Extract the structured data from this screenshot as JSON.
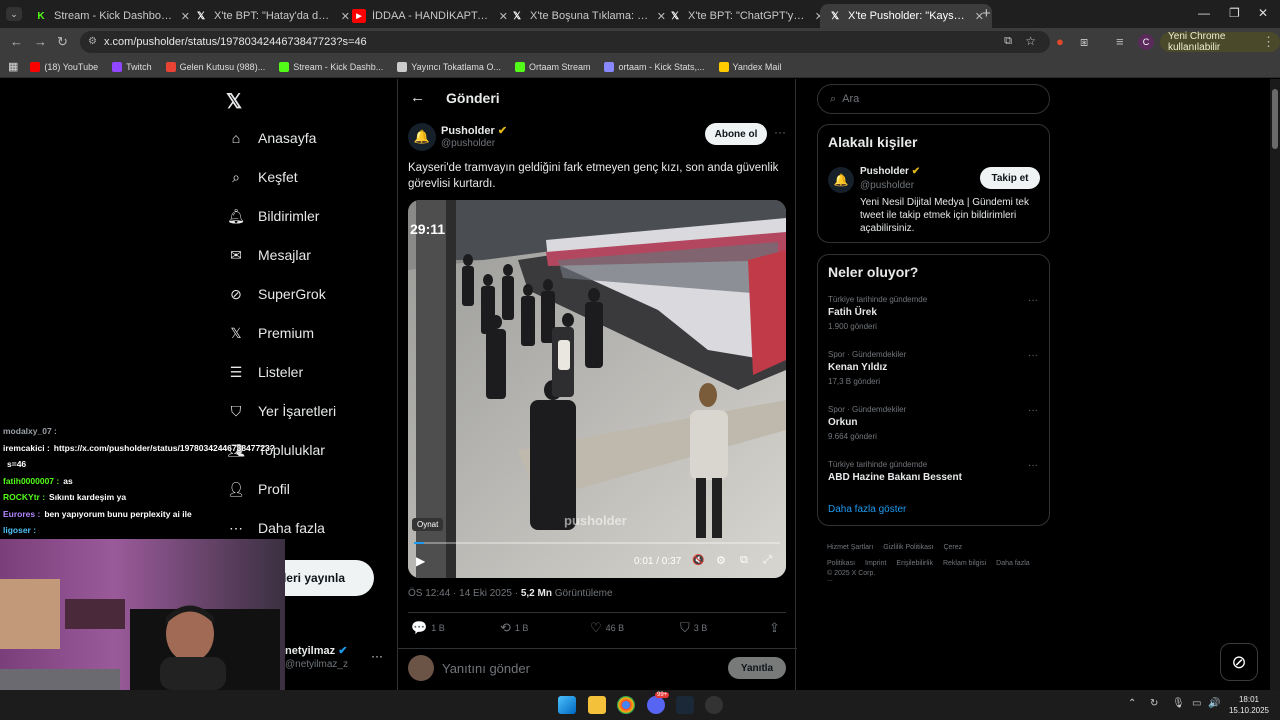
{
  "browser": {
    "tabs": [
      {
        "title": "Stream - Kick Dashboard",
        "icon": "kick-icon",
        "color": "#53fc18"
      },
      {
        "title": "X'te BPT: \"Hatay'da depremin e",
        "icon": "x-icon",
        "color": "#ffffff"
      },
      {
        "title": "İDDAA - HANDİKAPTAN KAZAN",
        "icon": "youtube-icon",
        "color": "#ff0000"
      },
      {
        "title": "X'te Boşuna Tıklama: \"Japonya'",
        "icon": "x-icon",
        "color": "#ffffff"
      },
      {
        "title": "X'te BPT: \"ChatGPT'ye cinsel içe",
        "icon": "x-icon",
        "color": "#ffffff"
      },
      {
        "title": "X'te Pusholder: \"Kayseri'de tram",
        "icon": "x-icon",
        "color": "#ffffff",
        "active": true
      }
    ],
    "url": "x.com/pusholder/status/1978034244673847723?s=46",
    "new_chrome_label": "Yeni Chrome kullanılabilir",
    "profile_initial": "C",
    "bookmarks": [
      {
        "label": "(18) YouTube",
        "color": "#ff0000"
      },
      {
        "label": "Twitch",
        "color": "#9146ff"
      },
      {
        "label": "Gelen Kutusu (988)...",
        "color": "#ea4335"
      },
      {
        "label": "Stream - Kick Dashb...",
        "color": "#53fc18"
      },
      {
        "label": "Yayıncı Tokatlama O...",
        "color": "#cccccc"
      },
      {
        "label": "Ortaam Stream",
        "color": "#53fc18"
      },
      {
        "label": "ortaam - Kick Stats,...",
        "color": "#8888ff"
      },
      {
        "label": "Yandex Mail",
        "color": "#ffcc00"
      }
    ]
  },
  "nav": {
    "items": [
      {
        "label": "Anasayfa",
        "icon": "home-icon"
      },
      {
        "label": "Keşfet",
        "icon": "search-icon"
      },
      {
        "label": "Bildirimler",
        "icon": "bell-icon"
      },
      {
        "label": "Mesajlar",
        "icon": "mail-icon"
      },
      {
        "label": "SuperGrok",
        "icon": "grok-icon"
      },
      {
        "label": "Premium",
        "icon": "x-icon"
      },
      {
        "label": "Listeler",
        "icon": "list-icon"
      },
      {
        "label": "Yer İşaretleri",
        "icon": "bookmark-icon"
      },
      {
        "label": "Topluluklar",
        "icon": "people-icon"
      },
      {
        "label": "Profil",
        "icon": "user-icon"
      },
      {
        "label": "Daha fazla",
        "icon": "more-circle-icon"
      }
    ],
    "post_button": "Gönderi yayınla",
    "account_name": "netyilmaz",
    "account_handle": "@netyilmaz_z"
  },
  "post": {
    "header_title": "Gönderi",
    "author_name": "Pusholder",
    "author_handle": "@pusholder",
    "subscribe_label": "Abone ol",
    "text": "Kayseri'de tramvayın geldiğini fark etmeyen genç kızı, son anda güvenlik görevlisi kurtardı.",
    "video": {
      "timestamp_overlay": "29:11",
      "watermark": "pusholder",
      "play_tooltip": "Oynat",
      "time": "0:01 / 0:37",
      "progress": 0.027
    },
    "meta_time": "ÖS 12:44 · 14 Eki 2025 · ",
    "views_count": "5,2 Mn",
    "views_label": " Görüntüleme",
    "stats": {
      "replies": "1 B",
      "reposts": "1 B",
      "likes": "46 B",
      "bookmarks": "3 B"
    },
    "reply_placeholder": "Yanıtını gönder",
    "reply_button": "Yanıtla"
  },
  "sidebar": {
    "search_placeholder": "Ara",
    "related_title": "Alakalı kişiler",
    "related": {
      "name": "Pusholder",
      "handle": "@pusholder",
      "follow_label": "Takip et",
      "bio": "Yeni Nesil Dijital Medya | Gündemi tek tweet ile takip etmek için bildirimleri açabilirsiniz."
    },
    "trends_title": "Neler oluyor?",
    "trends": [
      {
        "category": "Türkiye tarihinde gündemde",
        "name": "Fatih Ürek",
        "count": "1.900 gönderi"
      },
      {
        "category": "Spor · Gündemdekiler",
        "name": "Kenan Yıldız",
        "count": "17,3 B gönderi"
      },
      {
        "category": "Spor · Gündemdekiler",
        "name": "Orkun",
        "count": "9.664 gönderi"
      },
      {
        "category": "Türkiye tarihinde gündemde",
        "name": "ABD Hazine Bakanı Bessent",
        "count": ""
      }
    ],
    "show_more": "Daha fazla göster",
    "footer_links": [
      "Hizmet Şartları",
      "Gizlilik Politikası",
      "Çerez Politikası",
      "Imprint",
      "Erişilebilirlik",
      "Reklam bilgisi",
      "Daha fazla ..."
    ],
    "copyright": "© 2025 X Corp."
  },
  "overlay_chat": [
    {
      "user": "modalxy_07 :",
      "text": "",
      "color": "#9aa0a6"
    },
    {
      "user": "iremcakici :",
      "text": "https://x.com/pusholder/status/1978034244673847723?",
      "color": "#ffffff"
    },
    {
      "user": "",
      "text": "s=46",
      "color": "#ffffff"
    },
    {
      "user": "fatih0000007 :",
      "text": "as",
      "color": "#53fc18"
    },
    {
      "user": "ROCKYtr :",
      "text": "Sıkıntı kardeşim ya",
      "color": "#53fc18"
    },
    {
      "user": "Eurores :",
      "text": "ben yapıyorum bunu perplexity ai ile",
      "color": "#b388ff"
    },
    {
      "user": "ligoser :",
      "text": "",
      "color": "#4fc3f7"
    }
  ],
  "taskbar": {
    "time": "18:01",
    "date": "15.10.2025",
    "badge": "99+"
  }
}
